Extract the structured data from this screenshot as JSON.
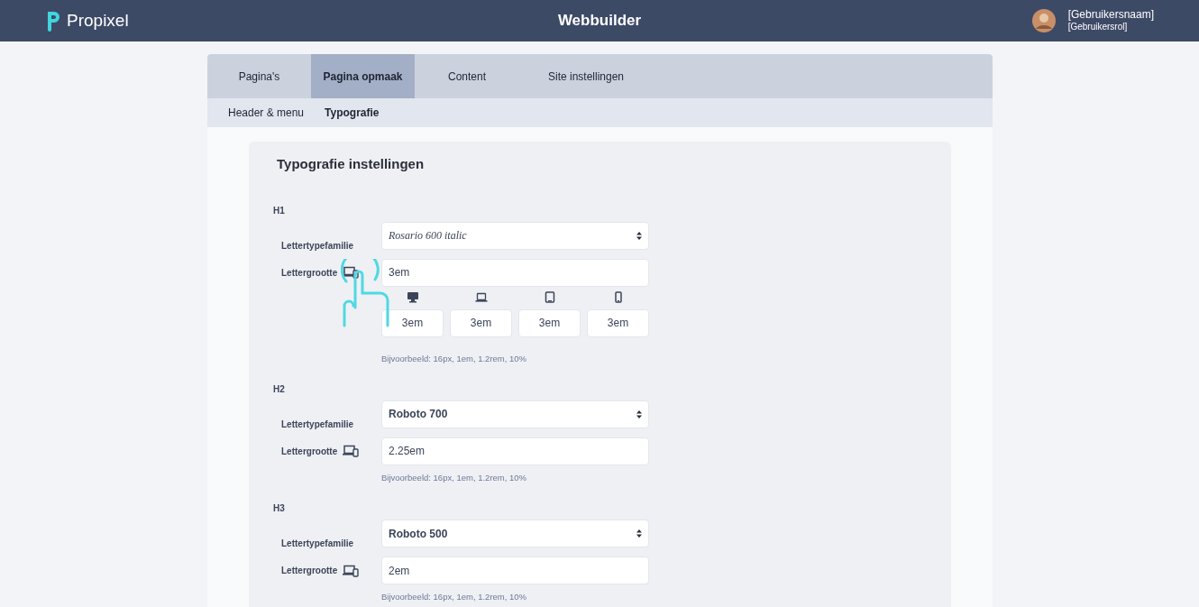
{
  "header": {
    "brand": "Propixel",
    "title": "Webbuilder",
    "user_name": "[Gebruikersnaam]",
    "user_role": "[Gebruikersrol]"
  },
  "tabs": [
    {
      "label": "Pagina's",
      "selected": false
    },
    {
      "label": "Pagina opmaak",
      "selected": true
    },
    {
      "label": "Content",
      "selected": false
    },
    {
      "label": "Site instellingen",
      "selected": false
    }
  ],
  "subtabs": [
    {
      "label": "Header & menu",
      "selected": false
    },
    {
      "label": "Typografie",
      "selected": true
    }
  ],
  "panel": {
    "title": "Typografie instellingen",
    "sections": [
      {
        "heading": "H1",
        "family_label": "Lettertypefamilie",
        "family": "Rosario 600 italic",
        "italic": true,
        "size_label": "Lettergrootte",
        "size": "3em",
        "expanded": true,
        "devices": [
          {
            "kind": "desktop",
            "value": "3em"
          },
          {
            "kind": "laptop",
            "value": "3em"
          },
          {
            "kind": "tablet",
            "value": "3em"
          },
          {
            "kind": "phone",
            "value": "3em"
          }
        ],
        "hint": "Bijvoorbeeld: 16px, 1em, 1.2rem, 10%"
      },
      {
        "heading": "H2",
        "family_label": "Lettertypefamilie",
        "family": "Roboto 700",
        "italic": false,
        "size_label": "Lettergrootte",
        "size": "2.25em",
        "expanded": false,
        "hint": "Bijvoorbeeld: 16px, 1em, 1.2rem, 10%"
      },
      {
        "heading": "H3",
        "family_label": "Lettertypefamilie",
        "family": "Roboto 500",
        "italic": false,
        "size_label": "Lettergrootte",
        "size": "2em",
        "expanded": false,
        "hint": "Bijvoorbeeld: 16px, 1em, 1.2rem, 10%"
      }
    ]
  }
}
